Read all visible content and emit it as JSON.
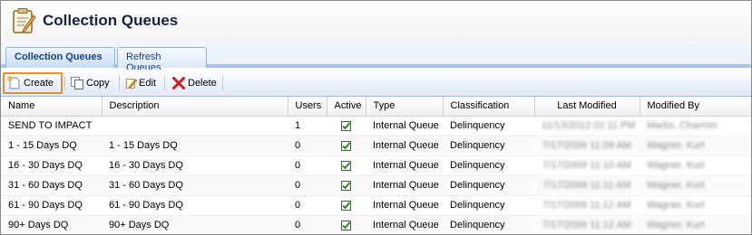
{
  "header": {
    "title": "Collection Queues"
  },
  "tabs": [
    {
      "label": "Collection Queues",
      "active": true
    },
    {
      "label": "Refresh Queues",
      "active": false
    }
  ],
  "toolbar": {
    "create_label": "Create",
    "copy_label": "Copy",
    "edit_label": "Edit",
    "delete_label": "Delete"
  },
  "grid": {
    "columns": [
      "Name",
      "Description",
      "Users",
      "Active",
      "Type",
      "Classification",
      "Last Modified",
      "Modified By"
    ],
    "rows": [
      {
        "name": "SEND TO IMPACT",
        "description": "",
        "users": "1",
        "active": true,
        "type": "Internal Queue",
        "classification": "Delinquency",
        "last_modified": "11/13/2012 01:11 PM",
        "modified_by": "Marks, Charmin"
      },
      {
        "name": "1 - 15 Days DQ",
        "description": "1 - 15 Days DQ",
        "users": "0",
        "active": true,
        "type": "Internal Queue",
        "classification": "Delinquency",
        "last_modified": "7/17/2009 11:09 AM",
        "modified_by": "Wagner, Kurt"
      },
      {
        "name": "16 - 30 Days DQ",
        "description": "16 - 30 Days DQ",
        "users": "0",
        "active": true,
        "type": "Internal Queue",
        "classification": "Delinquency",
        "last_modified": "7/17/2009 11:10 AM",
        "modified_by": "Wagner, Kurt"
      },
      {
        "name": "31 - 60 Days DQ",
        "description": "31 - 60 Days DQ",
        "users": "0",
        "active": true,
        "type": "Internal Queue",
        "classification": "Delinquency",
        "last_modified": "7/17/2009 11:11 AM",
        "modified_by": "Wagner, Kurt"
      },
      {
        "name": "61 - 90 Days DQ",
        "description": "61 - 90 Days DQ",
        "users": "0",
        "active": true,
        "type": "Internal Queue",
        "classification": "Delinquency",
        "last_modified": "7/17/2009 11:12 AM",
        "modified_by": "Wagner, Kurt"
      },
      {
        "name": "90+ Days DQ",
        "description": "90+ Days DQ",
        "users": "0",
        "active": true,
        "type": "Internal Queue",
        "classification": "Delinquency",
        "last_modified": "7/17/2009 11:12 AM",
        "modified_by": "Wagner, Kurt"
      }
    ]
  },
  "colors": {
    "accent": "#15428b",
    "highlight": "#f08a2c",
    "check": "#2d8a1e"
  }
}
